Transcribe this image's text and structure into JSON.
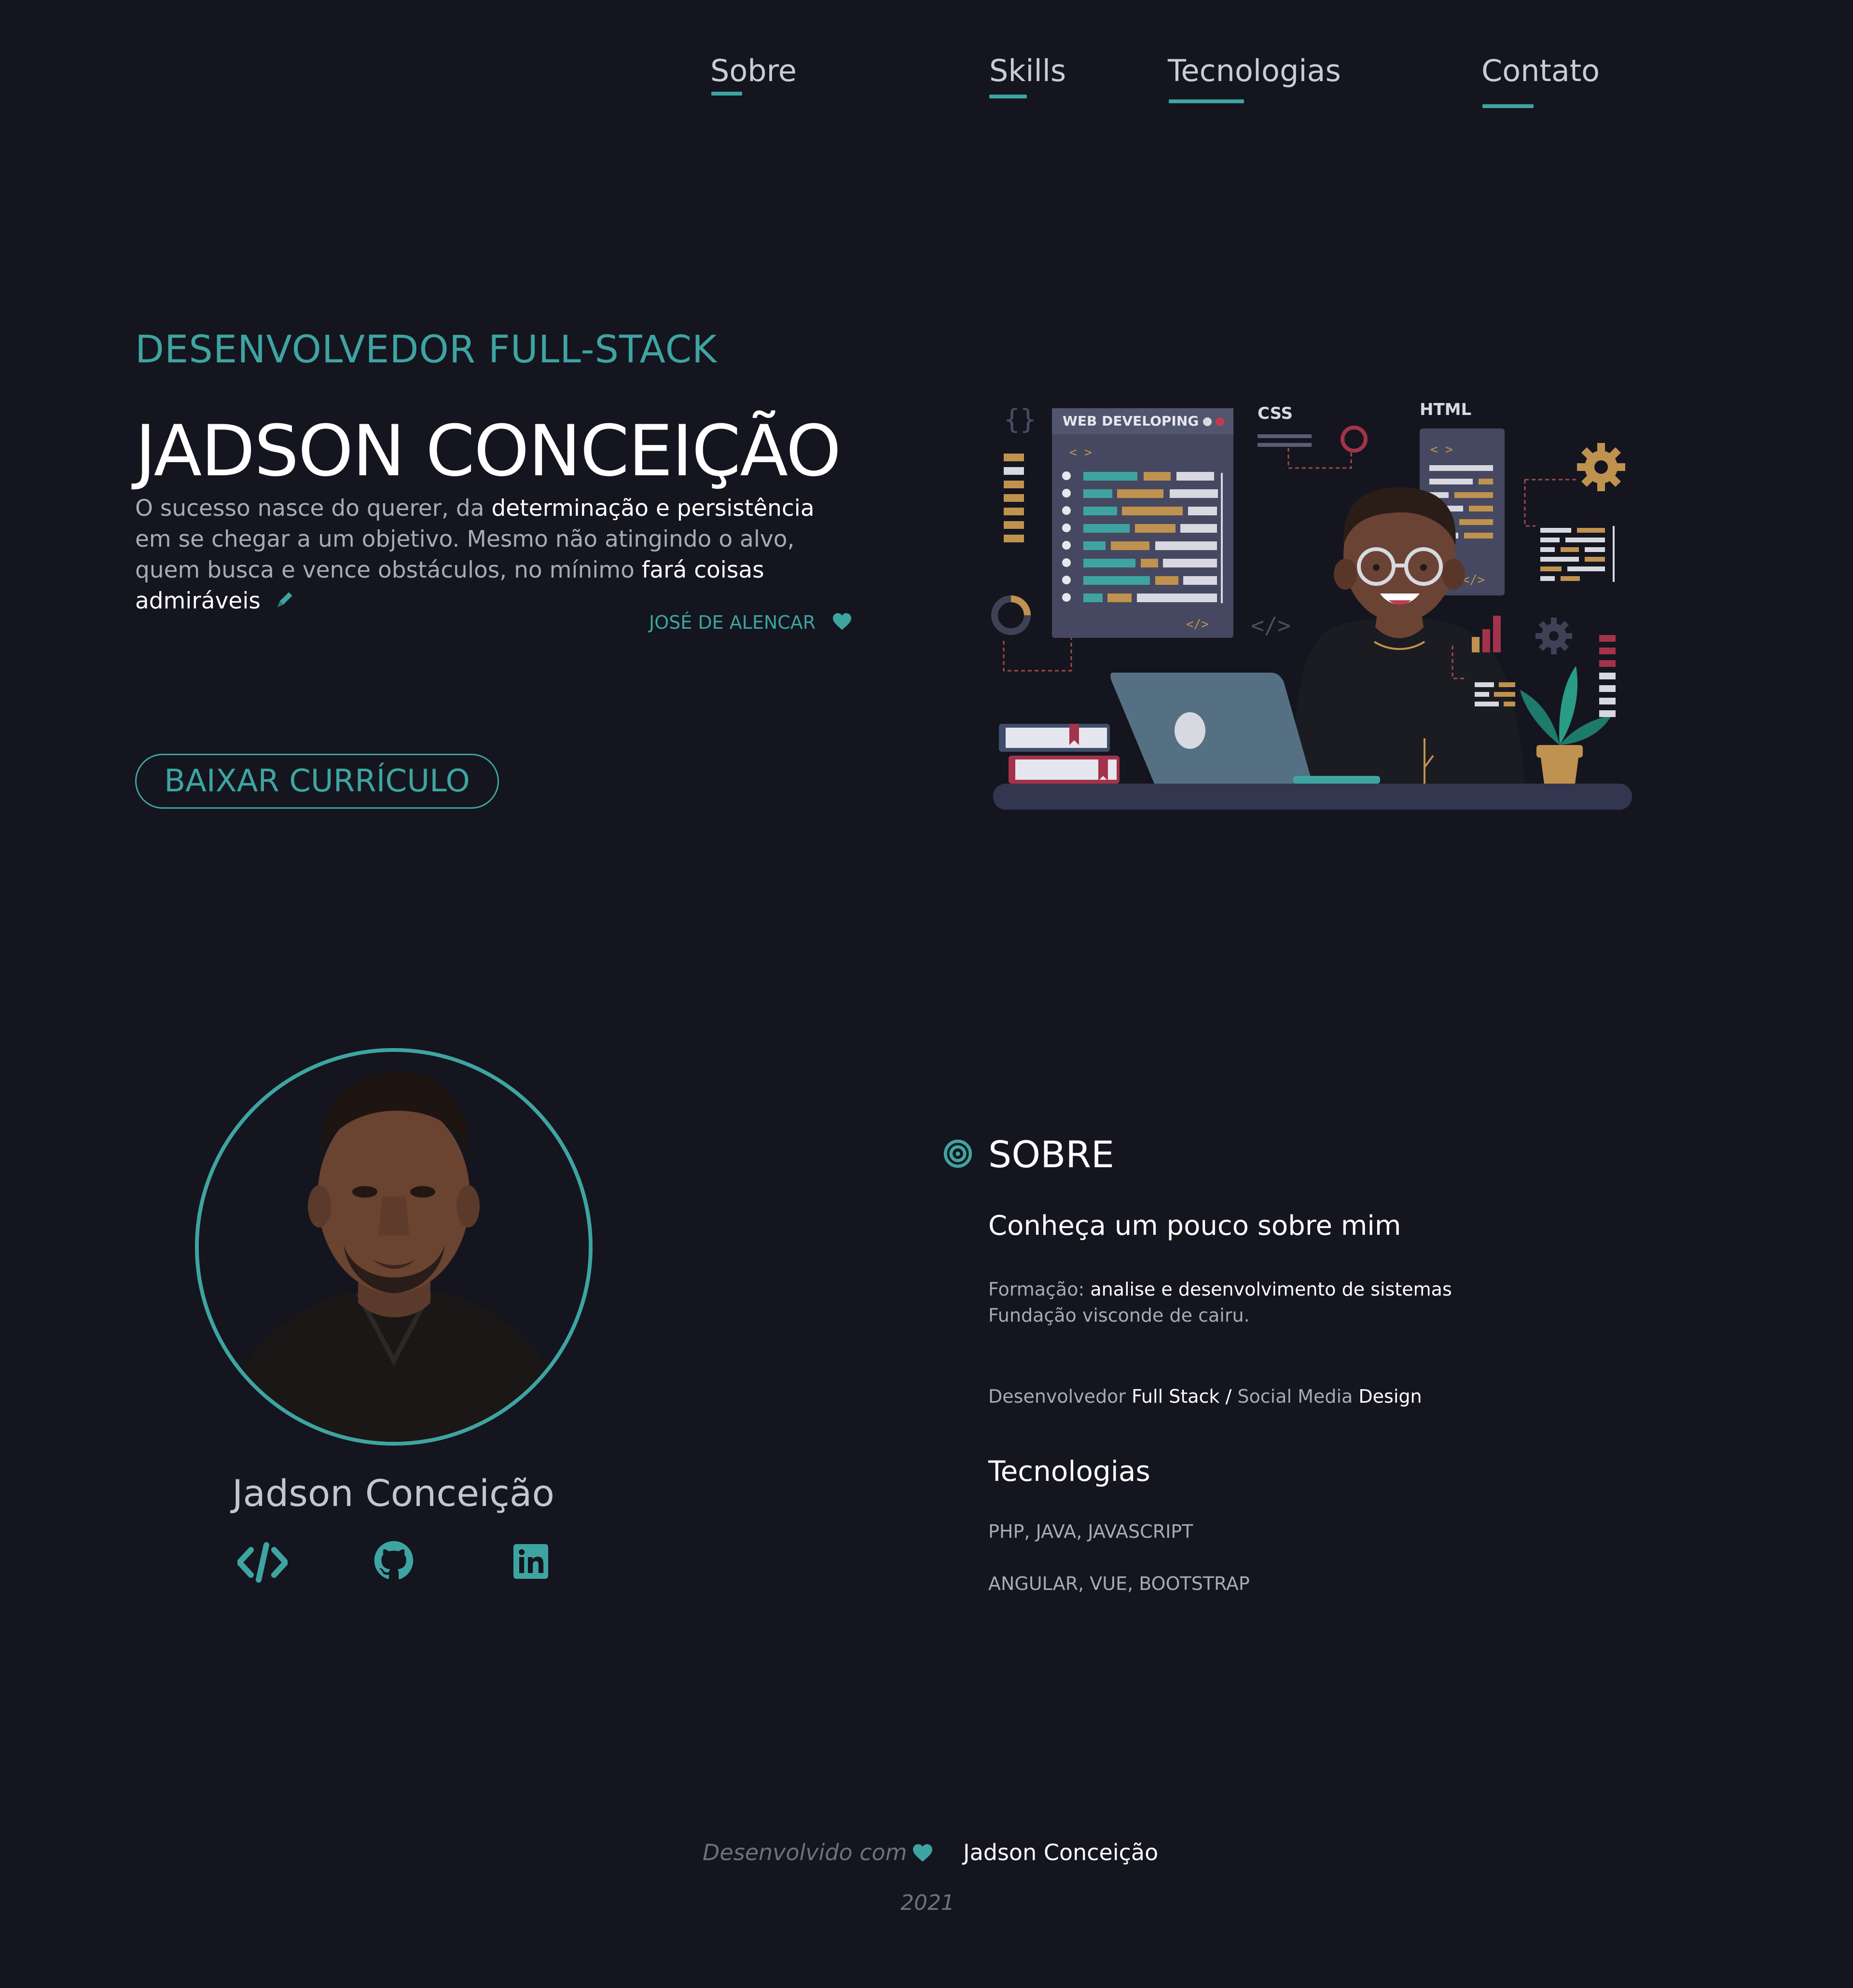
{
  "nav": {
    "items": [
      {
        "label": "Sobre"
      },
      {
        "label": "Skills"
      },
      {
        "label": "Tecnologias"
      },
      {
        "label": "Contato"
      }
    ]
  },
  "hero": {
    "role": "DESENVOLVEDOR FULL-STACK",
    "name": "JADSON CONCEIÇÃO",
    "quote": {
      "line1_a": "O sucesso nasce do querer, da ",
      "line1_b": "determinação e persistência",
      "line2": "em se chegar a um objetivo. Mesmo não atingindo o alvo,",
      "line3_a": "quem busca e vence obstáculos, no mínimo ",
      "line3_b": "fará coisas admiráveis"
    },
    "author": "JOSÉ DE ALENCAR",
    "button_label": "BAIXAR CURRÍCULO",
    "illustration": {
      "web_label": "WEB DEVELOPING",
      "css_label": "CSS",
      "html_label": "HTML",
      "tag_open": "< >",
      "tag_close": "</>"
    }
  },
  "profile": {
    "name": "Jadson Conceição",
    "links": [
      {
        "icon": "code-icon"
      },
      {
        "icon": "github-icon"
      },
      {
        "icon": "linkedin-icon"
      }
    ]
  },
  "about": {
    "title": "SOBRE",
    "subtitle": "Conheça um pouco sobre mim",
    "formation_label": "Formação:",
    "formation_value": "analise e desenvolvimento de sistemas",
    "institution": "Fundação visconde de cairu.",
    "role_1": "Desenvolvedor",
    "role_2": "Full Stack",
    "role_sep": "/",
    "role_3": "Social Media",
    "role_4": "Design",
    "tech_title": "Tecnologias",
    "tech_line1": "PHP, JAVA, JAVASCRIPT",
    "tech_line2": "ANGULAR, VUE, BOOTSTRAP"
  },
  "footer": {
    "made_with": "Desenvolvido com",
    "author": "Jadson Conceição",
    "year": "2021"
  },
  "colors": {
    "background": "#14151f",
    "accent": "#3ea4a1",
    "text": "#a8abb5",
    "highlight": "#ffffff"
  }
}
